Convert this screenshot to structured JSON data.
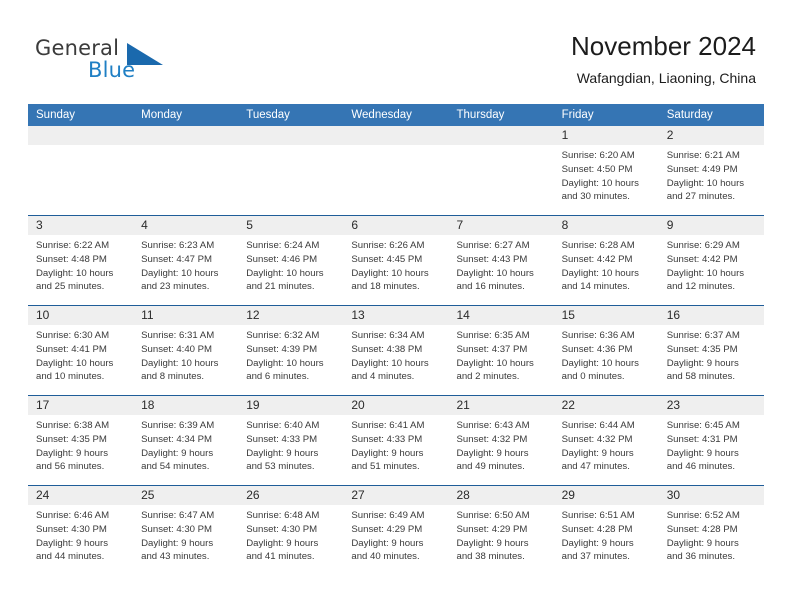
{
  "brand": {
    "name_part1": "General",
    "name_part2": "Blue",
    "triangle_color": "#1a69ad",
    "blue_color": "#1f7fc4"
  },
  "header": {
    "title": "November 2024",
    "subtitle": "Wafangdian, Liaoning, China"
  },
  "theme": {
    "header_blue": "#3575b4",
    "row_divider": "#1f5d99",
    "day_strip_gray": "#efefef"
  },
  "weekdays": [
    "Sunday",
    "Monday",
    "Tuesday",
    "Wednesday",
    "Thursday",
    "Friday",
    "Saturday"
  ],
  "weeks": [
    [
      {
        "day": "",
        "sunrise": "",
        "sunset": "",
        "daylight_line1": "",
        "daylight_line2": ""
      },
      {
        "day": "",
        "sunrise": "",
        "sunset": "",
        "daylight_line1": "",
        "daylight_line2": ""
      },
      {
        "day": "",
        "sunrise": "",
        "sunset": "",
        "daylight_line1": "",
        "daylight_line2": ""
      },
      {
        "day": "",
        "sunrise": "",
        "sunset": "",
        "daylight_line1": "",
        "daylight_line2": ""
      },
      {
        "day": "",
        "sunrise": "",
        "sunset": "",
        "daylight_line1": "",
        "daylight_line2": ""
      },
      {
        "day": "1",
        "sunrise": "Sunrise: 6:20 AM",
        "sunset": "Sunset: 4:50 PM",
        "daylight_line1": "Daylight: 10 hours",
        "daylight_line2": "and 30 minutes."
      },
      {
        "day": "2",
        "sunrise": "Sunrise: 6:21 AM",
        "sunset": "Sunset: 4:49 PM",
        "daylight_line1": "Daylight: 10 hours",
        "daylight_line2": "and 27 minutes."
      }
    ],
    [
      {
        "day": "3",
        "sunrise": "Sunrise: 6:22 AM",
        "sunset": "Sunset: 4:48 PM",
        "daylight_line1": "Daylight: 10 hours",
        "daylight_line2": "and 25 minutes."
      },
      {
        "day": "4",
        "sunrise": "Sunrise: 6:23 AM",
        "sunset": "Sunset: 4:47 PM",
        "daylight_line1": "Daylight: 10 hours",
        "daylight_line2": "and 23 minutes."
      },
      {
        "day": "5",
        "sunrise": "Sunrise: 6:24 AM",
        "sunset": "Sunset: 4:46 PM",
        "daylight_line1": "Daylight: 10 hours",
        "daylight_line2": "and 21 minutes."
      },
      {
        "day": "6",
        "sunrise": "Sunrise: 6:26 AM",
        "sunset": "Sunset: 4:45 PM",
        "daylight_line1": "Daylight: 10 hours",
        "daylight_line2": "and 18 minutes."
      },
      {
        "day": "7",
        "sunrise": "Sunrise: 6:27 AM",
        "sunset": "Sunset: 4:43 PM",
        "daylight_line1": "Daylight: 10 hours",
        "daylight_line2": "and 16 minutes."
      },
      {
        "day": "8",
        "sunrise": "Sunrise: 6:28 AM",
        "sunset": "Sunset: 4:42 PM",
        "daylight_line1": "Daylight: 10 hours",
        "daylight_line2": "and 14 minutes."
      },
      {
        "day": "9",
        "sunrise": "Sunrise: 6:29 AM",
        "sunset": "Sunset: 4:42 PM",
        "daylight_line1": "Daylight: 10 hours",
        "daylight_line2": "and 12 minutes."
      }
    ],
    [
      {
        "day": "10",
        "sunrise": "Sunrise: 6:30 AM",
        "sunset": "Sunset: 4:41 PM",
        "daylight_line1": "Daylight: 10 hours",
        "daylight_line2": "and 10 minutes."
      },
      {
        "day": "11",
        "sunrise": "Sunrise: 6:31 AM",
        "sunset": "Sunset: 4:40 PM",
        "daylight_line1": "Daylight: 10 hours",
        "daylight_line2": "and 8 minutes."
      },
      {
        "day": "12",
        "sunrise": "Sunrise: 6:32 AM",
        "sunset": "Sunset: 4:39 PM",
        "daylight_line1": "Daylight: 10 hours",
        "daylight_line2": "and 6 minutes."
      },
      {
        "day": "13",
        "sunrise": "Sunrise: 6:34 AM",
        "sunset": "Sunset: 4:38 PM",
        "daylight_line1": "Daylight: 10 hours",
        "daylight_line2": "and 4 minutes."
      },
      {
        "day": "14",
        "sunrise": "Sunrise: 6:35 AM",
        "sunset": "Sunset: 4:37 PM",
        "daylight_line1": "Daylight: 10 hours",
        "daylight_line2": "and 2 minutes."
      },
      {
        "day": "15",
        "sunrise": "Sunrise: 6:36 AM",
        "sunset": "Sunset: 4:36 PM",
        "daylight_line1": "Daylight: 10 hours",
        "daylight_line2": "and 0 minutes."
      },
      {
        "day": "16",
        "sunrise": "Sunrise: 6:37 AM",
        "sunset": "Sunset: 4:35 PM",
        "daylight_line1": "Daylight: 9 hours",
        "daylight_line2": "and 58 minutes."
      }
    ],
    [
      {
        "day": "17",
        "sunrise": "Sunrise: 6:38 AM",
        "sunset": "Sunset: 4:35 PM",
        "daylight_line1": "Daylight: 9 hours",
        "daylight_line2": "and 56 minutes."
      },
      {
        "day": "18",
        "sunrise": "Sunrise: 6:39 AM",
        "sunset": "Sunset: 4:34 PM",
        "daylight_line1": "Daylight: 9 hours",
        "daylight_line2": "and 54 minutes."
      },
      {
        "day": "19",
        "sunrise": "Sunrise: 6:40 AM",
        "sunset": "Sunset: 4:33 PM",
        "daylight_line1": "Daylight: 9 hours",
        "daylight_line2": "and 53 minutes."
      },
      {
        "day": "20",
        "sunrise": "Sunrise: 6:41 AM",
        "sunset": "Sunset: 4:33 PM",
        "daylight_line1": "Daylight: 9 hours",
        "daylight_line2": "and 51 minutes."
      },
      {
        "day": "21",
        "sunrise": "Sunrise: 6:43 AM",
        "sunset": "Sunset: 4:32 PM",
        "daylight_line1": "Daylight: 9 hours",
        "daylight_line2": "and 49 minutes."
      },
      {
        "day": "22",
        "sunrise": "Sunrise: 6:44 AM",
        "sunset": "Sunset: 4:32 PM",
        "daylight_line1": "Daylight: 9 hours",
        "daylight_line2": "and 47 minutes."
      },
      {
        "day": "23",
        "sunrise": "Sunrise: 6:45 AM",
        "sunset": "Sunset: 4:31 PM",
        "daylight_line1": "Daylight: 9 hours",
        "daylight_line2": "and 46 minutes."
      }
    ],
    [
      {
        "day": "24",
        "sunrise": "Sunrise: 6:46 AM",
        "sunset": "Sunset: 4:30 PM",
        "daylight_line1": "Daylight: 9 hours",
        "daylight_line2": "and 44 minutes."
      },
      {
        "day": "25",
        "sunrise": "Sunrise: 6:47 AM",
        "sunset": "Sunset: 4:30 PM",
        "daylight_line1": "Daylight: 9 hours",
        "daylight_line2": "and 43 minutes."
      },
      {
        "day": "26",
        "sunrise": "Sunrise: 6:48 AM",
        "sunset": "Sunset: 4:30 PM",
        "daylight_line1": "Daylight: 9 hours",
        "daylight_line2": "and 41 minutes."
      },
      {
        "day": "27",
        "sunrise": "Sunrise: 6:49 AM",
        "sunset": "Sunset: 4:29 PM",
        "daylight_line1": "Daylight: 9 hours",
        "daylight_line2": "and 40 minutes."
      },
      {
        "day": "28",
        "sunrise": "Sunrise: 6:50 AM",
        "sunset": "Sunset: 4:29 PM",
        "daylight_line1": "Daylight: 9 hours",
        "daylight_line2": "and 38 minutes."
      },
      {
        "day": "29",
        "sunrise": "Sunrise: 6:51 AM",
        "sunset": "Sunset: 4:28 PM",
        "daylight_line1": "Daylight: 9 hours",
        "daylight_line2": "and 37 minutes."
      },
      {
        "day": "30",
        "sunrise": "Sunrise: 6:52 AM",
        "sunset": "Sunset: 4:28 PM",
        "daylight_line1": "Daylight: 9 hours",
        "daylight_line2": "and 36 minutes."
      }
    ]
  ]
}
